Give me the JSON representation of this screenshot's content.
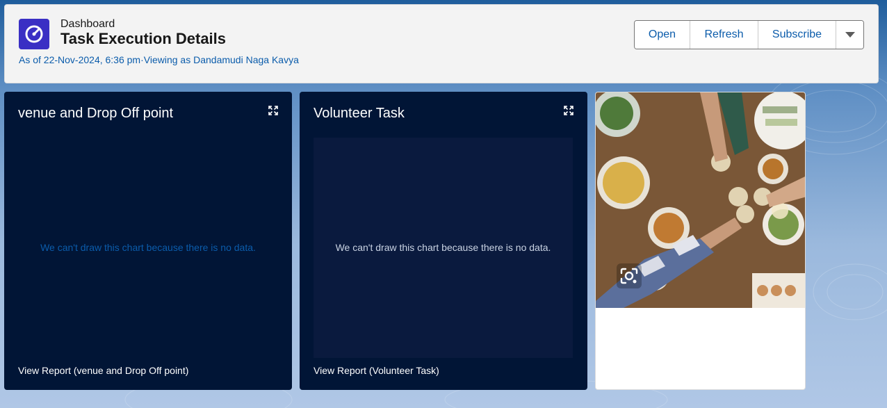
{
  "header": {
    "eyebrow": "Dashboard",
    "title": "Task Execution Details",
    "meta": "As of 22-Nov-2024, 6:36 pm·Viewing as Dandamudi Naga Kavya",
    "app_icon": "dashboard-gauge-icon",
    "buttons": {
      "open": "Open",
      "refresh": "Refresh",
      "subscribe": "Subscribe",
      "more_icon": "chevron-down-icon"
    }
  },
  "cards": [
    {
      "title": "venue and Drop Off point",
      "no_data": "We can't draw this chart because there is no data.",
      "view_report": "View Report (venue and Drop Off point)",
      "expand_icon": "expand-icon"
    },
    {
      "title": "Volunteer Task",
      "no_data": "We can't draw this chart because there is no data.",
      "view_report": "View Report (Volunteer Task)",
      "expand_icon": "expand-icon"
    }
  ],
  "image_card": {
    "overlay_icon": "visual-search-icon"
  },
  "colors": {
    "brand_icon": "#3a2fc4",
    "link": "#0b5cab",
    "card_bg": "#011536"
  }
}
